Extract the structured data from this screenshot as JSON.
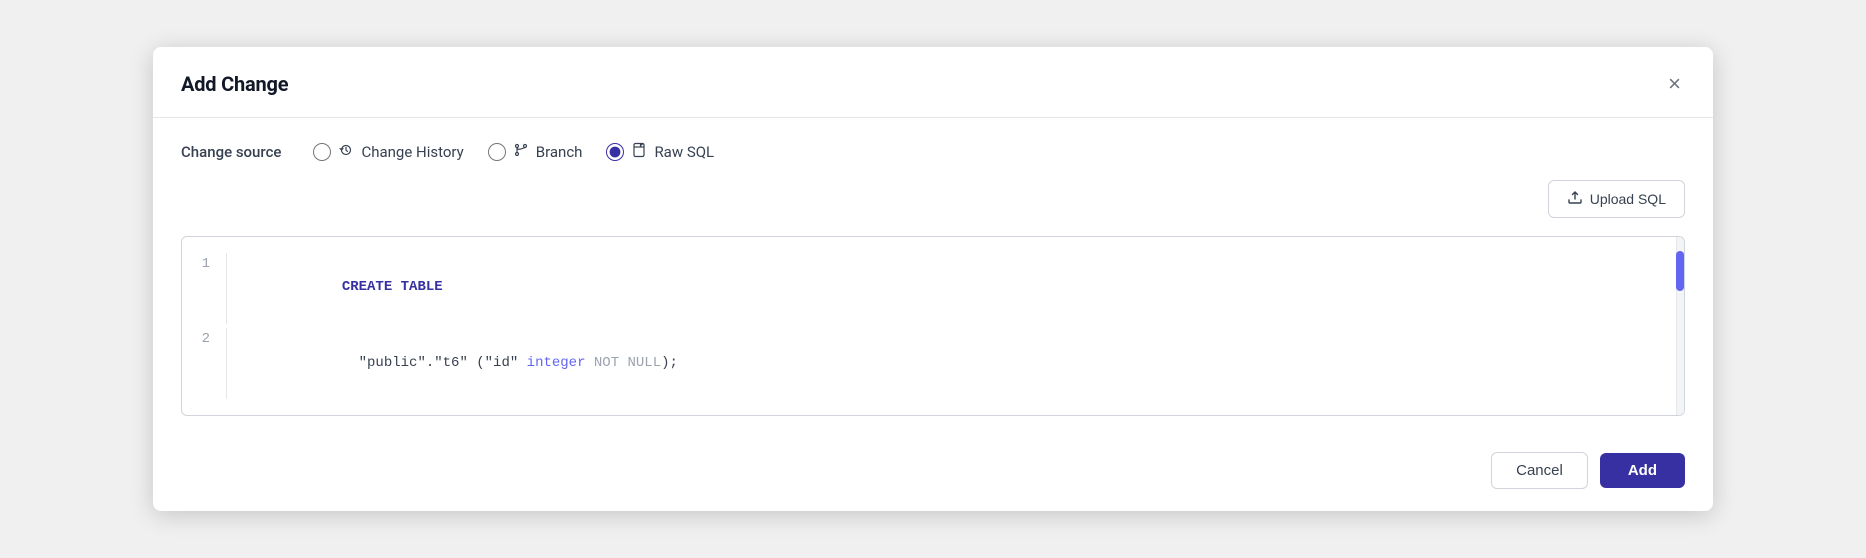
{
  "dialog": {
    "title": "Add Change",
    "close_label": "×"
  },
  "change_source": {
    "label": "Change source",
    "options": [
      {
        "id": "change-history",
        "label": "Change History",
        "icon": "🕐",
        "checked": false
      },
      {
        "id": "branch",
        "label": "Branch",
        "icon": "⎇",
        "checked": false
      },
      {
        "id": "raw-sql",
        "label": "Raw SQL",
        "icon": "📄",
        "checked": true
      }
    ]
  },
  "upload_button": {
    "label": "Upload SQL",
    "icon": "⬆"
  },
  "code_editor": {
    "lines": [
      {
        "number": "1",
        "content": "CREATE TABLE"
      },
      {
        "number": "2",
        "content": "  \"public\".\"t6\" (\"id\" integer NOT NULL);"
      }
    ]
  },
  "footer": {
    "cancel_label": "Cancel",
    "add_label": "Add"
  }
}
